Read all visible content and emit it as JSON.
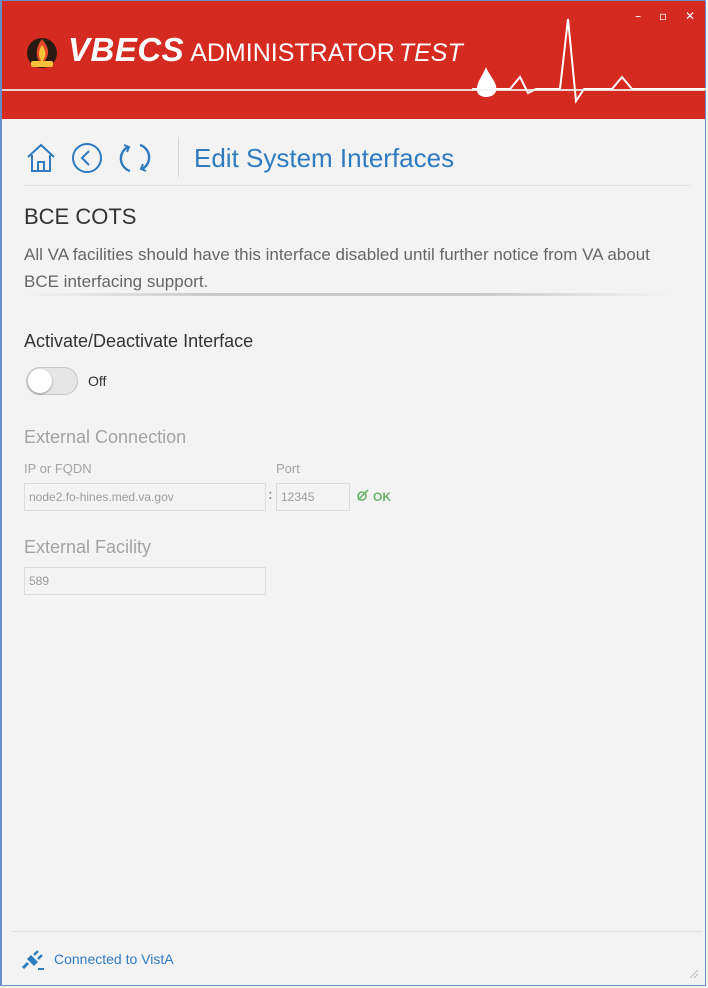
{
  "titlebar": {
    "app_name_bold": "VBECS",
    "app_name_regular": "ADMINISTRATOR",
    "app_name_env": "TEST",
    "controls": {
      "minimize": "–",
      "maximize": "▫",
      "close": "✕"
    },
    "brand_color": "#d42a20"
  },
  "nav": {
    "icons": [
      "home-icon",
      "back-icon",
      "refresh-icon"
    ],
    "page_title": "Edit System Interfaces",
    "accent_color": "#2f7bc0"
  },
  "section": {
    "title": "BCE COTS",
    "description": "All VA facilities should have this interface disabled until further notice from VA about BCE interfacing support."
  },
  "activation": {
    "label": "Activate/Deactivate Interface",
    "state": "Off"
  },
  "external_connection": {
    "heading": "External Connection",
    "ip_label": "IP or FQDN",
    "ip_value": "node2.fo-hines.med.va.gov",
    "separator": ":",
    "port_label": "Port",
    "port_value": "12345",
    "status": "OK",
    "status_icon": "connection-ok-icon",
    "status_color": "#6ab36a"
  },
  "external_facility": {
    "heading": "External Facility",
    "value": "589"
  },
  "footer": {
    "status_text": "Connected to VistA",
    "status_icon": "plug-icon"
  }
}
